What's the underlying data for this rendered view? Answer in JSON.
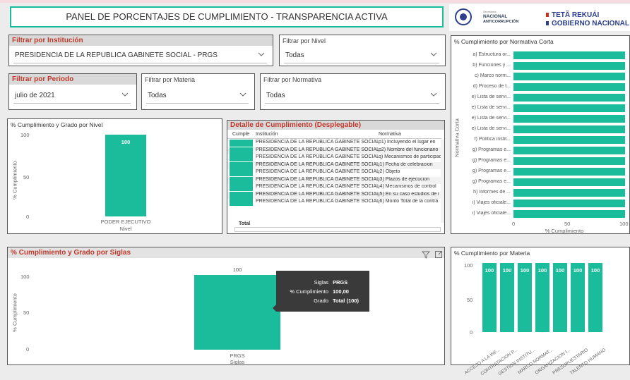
{
  "header": {
    "title": "PANEL DE PORCENTAJES DE CUMPLIMIENTO - TRANSPARENCIA ACTIVA"
  },
  "logos": {
    "sna_small": "Secretaría",
    "sna_line1": "NACIONAL",
    "sna_line2": "ANTICORRUPCIÓN",
    "gov_line1": "TETÃ REKUÁI",
    "gov_line2": "GOBIERNO NACIONAL"
  },
  "filters": {
    "institucion": {
      "label": "Filtrar por Institución",
      "value": "PRESIDENCIA DE LA REPUBLICA GABINETE SOCIAL - PRGS"
    },
    "nivel": {
      "label": "Filtrar por Nivel",
      "value": "Todas"
    },
    "periodo": {
      "label": "Filtrar por Periodo",
      "value": "julio de 2021"
    },
    "materia": {
      "label": "Filtrar por Materia",
      "value": "Todas"
    },
    "normativa": {
      "label": "Filtrar por Normativa",
      "value": "Todas"
    }
  },
  "nivel_chart": {
    "title": "% Cumplimiento y Grado por Nivel",
    "ylabel": "% Cumplimiento",
    "xlabel": "Nivel",
    "yticks": [
      "100",
      "50",
      "0"
    ]
  },
  "detalle": {
    "title": "Detalle de Cumplimiento (Desplegable)",
    "col_cumple": "Cumple",
    "col_inst": "Institución",
    "col_norm": "Normativa",
    "total_label": "Total",
    "rows": [
      {
        "inst": "PRESIDENCIA DE LA REPUBLICA GABINETE SOCIAL",
        "norm": "p1) Incluyendo el lugar en"
      },
      {
        "inst": "PRESIDENCIA DE LA REPUBLICA GABINETE SOCIAL",
        "norm": "p2) Nombre del funcionario"
      },
      {
        "inst": "PRESIDENCIA DE LA REPUBLICA GABINETE SOCIAL",
        "norm": "q) Mecanismos de participac"
      },
      {
        "inst": "PRESIDENCIA DE LA REPUBLICA GABINETE SOCIAL",
        "norm": "j1) Fecha de celebracion"
      },
      {
        "inst": "PRESIDENCIA DE LA REPUBLICA GABINETE SOCIAL",
        "norm": "j2) Objeto"
      },
      {
        "inst": "PRESIDENCIA DE LA REPUBLICA GABINETE SOCIAL",
        "norm": "j3) Plazos de ejecucion"
      },
      {
        "inst": "PRESIDENCIA DE LA REPUBLICA GABINETE SOCIAL",
        "norm": "j4) Mecanismos de control"
      },
      {
        "inst": "PRESIDENCIA DE LA REPUBLICA GABINETE SOCIAL",
        "norm": "j5) En su caso estudios de i"
      },
      {
        "inst": "PRESIDENCIA DE LA REPUBLICA GABINETE SOCIAL",
        "norm": "j6) Monto Total de la contra"
      }
    ]
  },
  "normativa_chart": {
    "title": "% Cumplimiento por Normativa Corta",
    "ylabel": "Normativa Corta",
    "xlabel": "% Cumplimiento",
    "xticks": [
      "0",
      "50",
      "100"
    ]
  },
  "siglas_chart": {
    "title": "% Cumplimiento y Grado por Siglas",
    "ylabel": "% Cumplimiento",
    "xlabel": "Siglas",
    "yticks": [
      "100",
      "50",
      "0"
    ],
    "tooltip": {
      "k1": "Siglas",
      "v1": "PRGS",
      "k2": "% Cumplimiento",
      "v2": "100,00",
      "k3": "Grado",
      "v3": "Total (100)"
    }
  },
  "materia_chart": {
    "title": "% Cumplimiento por Materia",
    "yticks": [
      "100",
      "50",
      "0"
    ]
  },
  "chart_data": [
    {
      "type": "bar",
      "title": "% Cumplimiento y Grado por Nivel",
      "categories": [
        "PODER EJECUTIVO"
      ],
      "values": [
        100
      ],
      "xlabel": "Nivel",
      "ylabel": "% Cumplimiento",
      "ylim": [
        0,
        100
      ]
    },
    {
      "type": "bar",
      "orientation": "horizontal",
      "title": "% Cumplimiento por Normativa Corta",
      "categories": [
        "a) Estructura or...",
        "b) Funciones y ...",
        "c) Marco norm...",
        "d) Proceso de t...",
        "e) Lista de servi...",
        "e) Lista de servi...",
        "e) Lista de servi...",
        "e) Lista de servi...",
        "f) Política instit...",
        "g) Programas e...",
        "g) Programas e...",
        "g) Programas e...",
        "g) Programas e...",
        "h) Informes de ...",
        "i) Viajes oficiale...",
        "i) Viajes oficiale..."
      ],
      "values": [
        100,
        100,
        100,
        100,
        100,
        100,
        100,
        100,
        100,
        100,
        100,
        100,
        100,
        100,
        100,
        100
      ],
      "xlabel": "% Cumplimiento",
      "ylabel": "Normativa Corta",
      "xlim": [
        0,
        100
      ]
    },
    {
      "type": "bar",
      "title": "% Cumplimiento y Grado por Siglas",
      "categories": [
        "PRGS"
      ],
      "values": [
        100
      ],
      "xlabel": "Siglas",
      "ylabel": "% Cumplimiento",
      "ylim": [
        0,
        100
      ]
    },
    {
      "type": "bar",
      "title": "% Cumplimiento por Materia",
      "categories": [
        "ACCESO A LA INF...",
        "CONTRATACION P...",
        "GESTION INSTITU...",
        "MARCO NORMAT...",
        "ORGANIZACION I...",
        "PRESUPUESTARIO",
        "TALENTO HUMANO"
      ],
      "values": [
        100,
        100,
        100,
        100,
        100,
        100,
        100
      ],
      "ylim": [
        0,
        100
      ]
    }
  ],
  "colors": {
    "bar": "#1abc9c",
    "title_red": "#c0392b",
    "header_border": "#1abc9c"
  }
}
